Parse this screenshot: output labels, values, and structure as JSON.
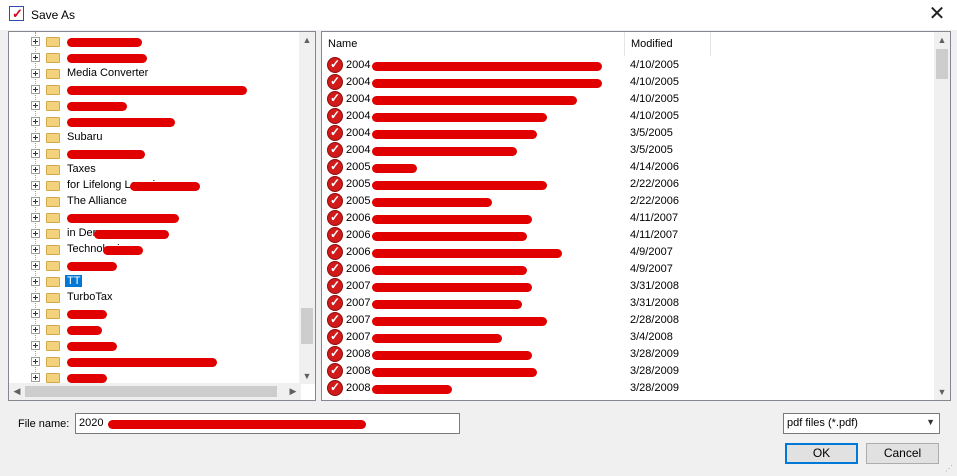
{
  "window": {
    "title": "Save As",
    "close_glyph": "✕"
  },
  "tree": {
    "items": [
      {
        "label": "",
        "redact": 75
      },
      {
        "label": "",
        "redact": 80
      },
      {
        "label": "Media Converter",
        "redact": 0
      },
      {
        "label": "",
        "redact": 180
      },
      {
        "label": "",
        "redact": 60
      },
      {
        "label": "",
        "redact": 108
      },
      {
        "label": "Subaru",
        "redact": 0
      },
      {
        "label": "",
        "redact": 78
      },
      {
        "label": "Taxes",
        "redact": 0
      },
      {
        "label": "for Lifelong Learning",
        "redact": 70
      },
      {
        "label": "The Alliance",
        "redact": 0
      },
      {
        "label": "",
        "redact": 112
      },
      {
        "label": "in Denver",
        "redact": 75
      },
      {
        "label": "Technologies",
        "redact": 40
      },
      {
        "label": "",
        "redact": 50
      },
      {
        "label": "TT",
        "redact": 0,
        "selected": true
      },
      {
        "label": "TurboTax",
        "redact": 0
      },
      {
        "label": "",
        "redact": 40
      },
      {
        "label": "",
        "redact": 35
      },
      {
        "label": "",
        "redact": 50
      },
      {
        "label": "",
        "redact": 150
      },
      {
        "label": "",
        "redact": 40
      }
    ]
  },
  "file_list": {
    "columns": {
      "name": "Name",
      "modified": "Modified"
    },
    "rows": [
      {
        "name": "2004",
        "modified": "4/10/2005",
        "redact": 230
      },
      {
        "name": "2004",
        "modified": "4/10/2005",
        "redact": 230
      },
      {
        "name": "2004",
        "modified": "4/10/2005",
        "redact": 205
      },
      {
        "name": "2004",
        "modified": "4/10/2005",
        "redact": 175
      },
      {
        "name": "2004",
        "modified": "3/5/2005",
        "redact": 165
      },
      {
        "name": "2004",
        "modified": "3/5/2005",
        "redact": 145
      },
      {
        "name": "2005",
        "modified": "4/14/2006",
        "redact": 45
      },
      {
        "name": "2005",
        "modified": "2/22/2006",
        "redact": 175
      },
      {
        "name": "2005",
        "modified": "2/22/2006",
        "redact": 120
      },
      {
        "name": "2006",
        "modified": "4/11/2007",
        "redact": 160
      },
      {
        "name": "2006",
        "modified": "4/11/2007",
        "redact": 155
      },
      {
        "name": "2006",
        "modified": "4/9/2007",
        "redact": 190
      },
      {
        "name": "2006",
        "modified": "4/9/2007",
        "redact": 155
      },
      {
        "name": "2007",
        "modified": "3/31/2008",
        "redact": 160
      },
      {
        "name": "2007",
        "modified": "3/31/2008",
        "redact": 150
      },
      {
        "name": "2007",
        "modified": "2/28/2008",
        "redact": 175
      },
      {
        "name": "2007",
        "modified": "3/4/2008",
        "redact": 130
      },
      {
        "name": "2008",
        "modified": "3/28/2009",
        "redact": 160
      },
      {
        "name": "2008",
        "modified": "3/28/2009",
        "redact": 165
      },
      {
        "name": "2008",
        "modified": "3/28/2009",
        "redact": 80
      }
    ]
  },
  "bottom": {
    "file_name_label": "File name:",
    "file_name_value": "2020",
    "file_type_value": "pdf files (*.pdf)",
    "ok_label": "OK",
    "cancel_label": "Cancel"
  },
  "colors": {
    "redaction": "#e10000",
    "selection": "#0078d7"
  }
}
